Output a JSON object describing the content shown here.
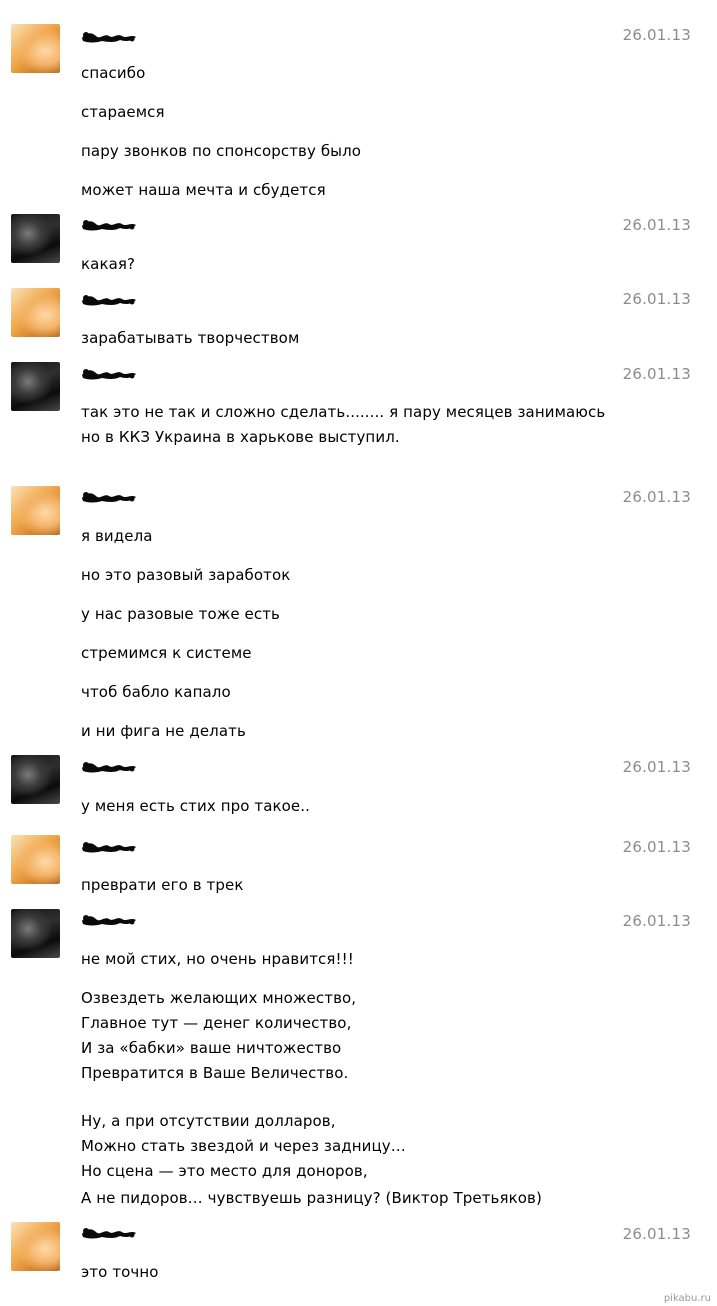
{
  "messages": [
    {
      "avatar": "blonde",
      "date": "26.01.13",
      "lines": [
        "спасибо",
        "стараемся",
        "пару звонков по спонсорству было",
        "может наша мечта и сбудется"
      ]
    },
    {
      "avatar": "dark",
      "date": "26.01.13",
      "lines": [
        "какая?"
      ]
    },
    {
      "avatar": "blonde",
      "date": "26.01.13",
      "lines": [
        "зарабатывать творчеством"
      ]
    },
    {
      "avatar": "dark",
      "date": "26.01.13",
      "lines": [
        "так это не так и сложно сделать........ я пару месяцев занимаюсь",
        "но в ККЗ Украина в харькове выступил."
      ]
    },
    {
      "avatar": "blonde",
      "date": "26.01.13",
      "lines": [
        "я видела",
        "но это разовый заработок",
        "у нас разовые тоже есть",
        "стремимся к системе",
        "чтоб бабло капало",
        "и ни фига не делать"
      ]
    },
    {
      "avatar": "dark",
      "date": "26.01.13",
      "lines": [
        "у меня есть стих про такое.."
      ]
    },
    {
      "avatar": "blonde",
      "date": "26.01.13",
      "lines": [
        "преврати его в трек"
      ]
    },
    {
      "avatar": "dark",
      "date": "26.01.13",
      "lines": [
        "не мой стих, но очень нравится!!!",
        "Озвездеть желающих множество,",
        "Главное тут — денег количество,",
        "И за «бабки» ваше ничтожество",
        "Превратится в Ваше Величество.",
        "Ну, а при отсутствии долларов,",
        "Можно стать звездой и через задницу…",
        "Но сцена — это место для доноров,",
        "А не пидоров… чувствуешь разницу? (Виктор Третьяков)"
      ]
    },
    {
      "avatar": "blonde",
      "date": "26.01.13",
      "lines": [
        "это точно"
      ]
    }
  ],
  "watermark": "pikabu.ru"
}
